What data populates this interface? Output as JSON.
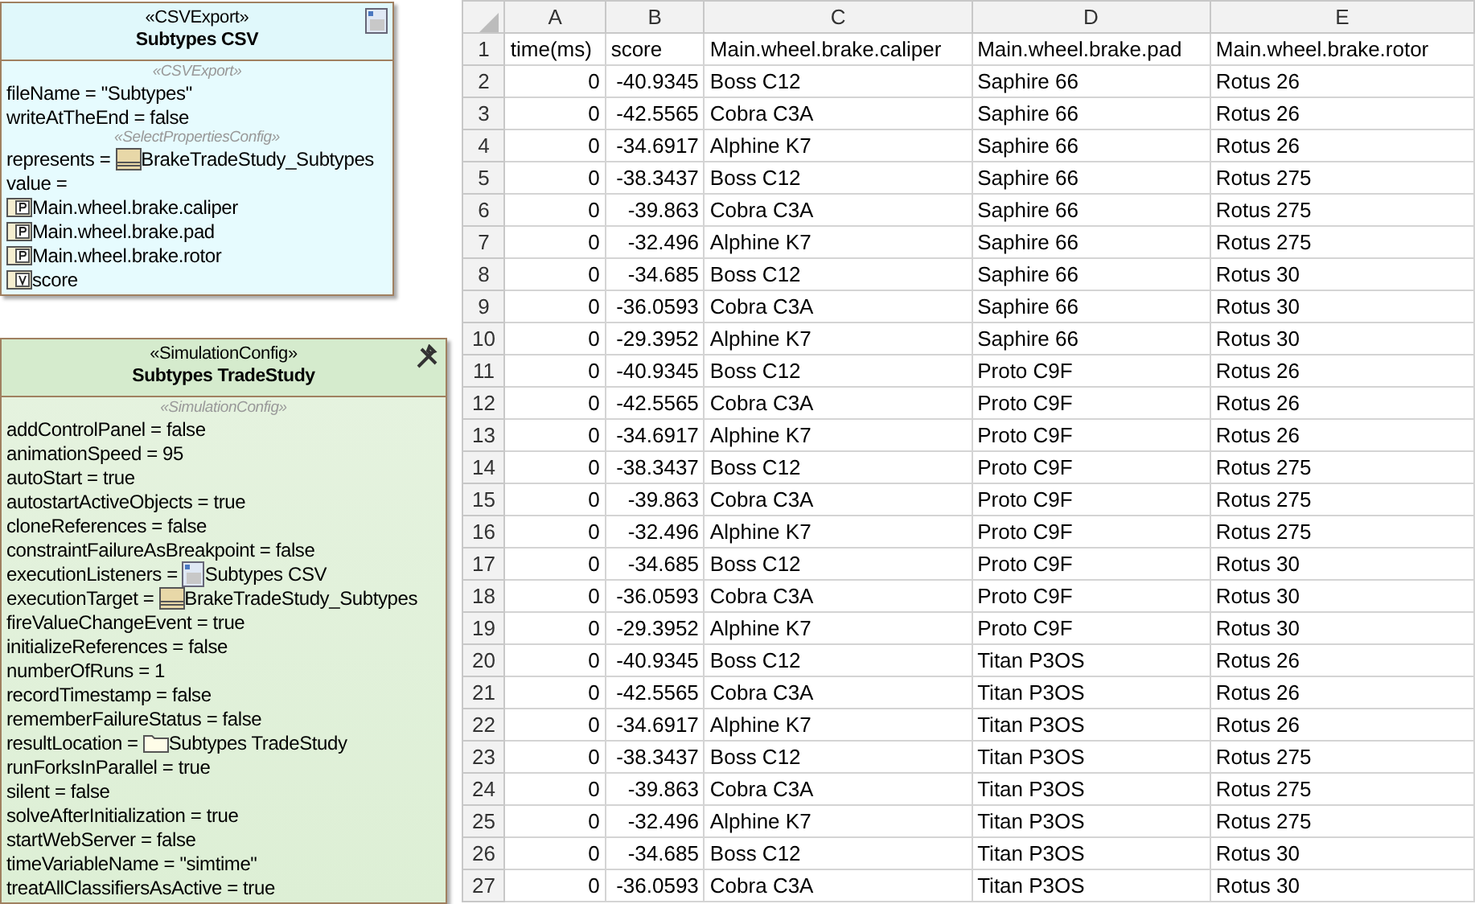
{
  "diagram": {
    "boxes": [
      {
        "kind": "csv",
        "stereotype": "«CSVExport»",
        "title": "Subtypes CSV",
        "sections": [
          {
            "stereotype": "«CSVExport»",
            "properties": [
              {
                "label": "fileName = \"Subtypes\""
              },
              {
                "label": "writeAtTheEnd = false"
              }
            ]
          },
          {
            "stereotype": "«SelectPropertiesConfig»",
            "properties": [
              {
                "label": "represents =",
                "kind": "block",
                "value": "BrakeTradeStudy_Subtypes"
              },
              {
                "label": "value ="
              },
              {
                "kind": "part",
                "value": "Main.wheel.brake.caliper"
              },
              {
                "kind": "part",
                "value": "Main.wheel.brake.pad"
              },
              {
                "kind": "part",
                "value": "Main.wheel.brake.rotor"
              },
              {
                "kind": "valueprop",
                "value": "score"
              }
            ]
          }
        ]
      },
      {
        "kind": "sim",
        "stereotype": "«SimulationConfig»",
        "title": "Subtypes TradeStudy",
        "sections": [
          {
            "stereotype": "«SimulationConfig»",
            "properties": [
              {
                "label": "addControlPanel = false"
              },
              {
                "label": "animationSpeed = 95"
              },
              {
                "label": "autoStart = true"
              },
              {
                "label": "autostartActiveObjects = true"
              },
              {
                "label": "cloneReferences = false"
              },
              {
                "label": "constraintFailureAsBreakpoint = false"
              },
              {
                "label": "executionListeners =",
                "kind": "csv",
                "value": "Subtypes CSV"
              },
              {
                "label": "executionTarget =",
                "kind": "block",
                "value": "BrakeTradeStudy_Subtypes"
              },
              {
                "label": "fireValueChangeEvent = true"
              },
              {
                "label": "initializeReferences = false"
              },
              {
                "label": "numberOfRuns = 1"
              },
              {
                "label": "recordTimestamp = false"
              },
              {
                "label": "rememberFailureStatus = false"
              },
              {
                "label": "resultLocation =",
                "kind": "folder",
                "value": "Subtypes TradeStudy"
              },
              {
                "label": "runForksInParallel = true"
              },
              {
                "label": "silent = false"
              },
              {
                "label": "solveAfterInitialization = true"
              },
              {
                "label": "startWebServer = false"
              },
              {
                "label": "timeVariableName = \"simtime\""
              },
              {
                "label": "treatAllClassifiersAsActive = true"
              }
            ]
          }
        ]
      }
    ]
  },
  "sheet": {
    "columns": [
      "A",
      "B",
      "C",
      "D",
      "E"
    ],
    "rows": [
      {
        "number": "1",
        "cells": [
          "time(ms)",
          "score",
          "Main.wheel.brake.caliper",
          "Main.wheel.brake.pad",
          "Main.wheel.brake.rotor"
        ]
      },
      {
        "number": "2",
        "cells": [
          "0",
          "-40.9345",
          "Boss C12",
          "Saphire 66",
          "Rotus 26"
        ]
      },
      {
        "number": "3",
        "cells": [
          "0",
          "-42.5565",
          "Cobra C3A",
          "Saphire 66",
          "Rotus 26"
        ]
      },
      {
        "number": "4",
        "cells": [
          "0",
          "-34.6917",
          "Alphine K7",
          "Saphire 66",
          "Rotus 26"
        ]
      },
      {
        "number": "5",
        "cells": [
          "0",
          "-38.3437",
          "Boss C12",
          "Saphire 66",
          "Rotus 275"
        ]
      },
      {
        "number": "6",
        "cells": [
          "0",
          "-39.863",
          "Cobra C3A",
          "Saphire 66",
          "Rotus 275"
        ]
      },
      {
        "number": "7",
        "cells": [
          "0",
          "-32.496",
          "Alphine K7",
          "Saphire 66",
          "Rotus 275"
        ]
      },
      {
        "number": "8",
        "cells": [
          "0",
          "-34.685",
          "Boss C12",
          "Saphire 66",
          "Rotus 30"
        ]
      },
      {
        "number": "9",
        "cells": [
          "0",
          "-36.0593",
          "Cobra C3A",
          "Saphire 66",
          "Rotus 30"
        ]
      },
      {
        "number": "10",
        "cells": [
          "0",
          "-29.3952",
          "Alphine K7",
          "Saphire 66",
          "Rotus 30"
        ]
      },
      {
        "number": "11",
        "cells": [
          "0",
          "-40.9345",
          "Boss C12",
          "Proto C9F",
          "Rotus 26"
        ]
      },
      {
        "number": "12",
        "cells": [
          "0",
          "-42.5565",
          "Cobra C3A",
          "Proto C9F",
          "Rotus 26"
        ]
      },
      {
        "number": "13",
        "cells": [
          "0",
          "-34.6917",
          "Alphine K7",
          "Proto C9F",
          "Rotus 26"
        ]
      },
      {
        "number": "14",
        "cells": [
          "0",
          "-38.3437",
          "Boss C12",
          "Proto C9F",
          "Rotus 275"
        ]
      },
      {
        "number": "15",
        "cells": [
          "0",
          "-39.863",
          "Cobra C3A",
          "Proto C9F",
          "Rotus 275"
        ]
      },
      {
        "number": "16",
        "cells": [
          "0",
          "-32.496",
          "Alphine K7",
          "Proto C9F",
          "Rotus 275"
        ]
      },
      {
        "number": "17",
        "cells": [
          "0",
          "-34.685",
          "Boss C12",
          "Proto C9F",
          "Rotus 30"
        ]
      },
      {
        "number": "18",
        "cells": [
          "0",
          "-36.0593",
          "Cobra C3A",
          "Proto C9F",
          "Rotus 30"
        ]
      },
      {
        "number": "19",
        "cells": [
          "0",
          "-29.3952",
          "Alphine K7",
          "Proto C9F",
          "Rotus 30"
        ]
      },
      {
        "number": "20",
        "cells": [
          "0",
          "-40.9345",
          "Boss C12",
          "Titan P3OS",
          "Rotus 26"
        ]
      },
      {
        "number": "21",
        "cells": [
          "0",
          "-42.5565",
          "Cobra C3A",
          "Titan P3OS",
          "Rotus 26"
        ]
      },
      {
        "number": "22",
        "cells": [
          "0",
          "-34.6917",
          "Alphine K7",
          "Titan P3OS",
          "Rotus 26"
        ]
      },
      {
        "number": "23",
        "cells": [
          "0",
          "-38.3437",
          "Boss C12",
          "Titan P3OS",
          "Rotus 275"
        ]
      },
      {
        "number": "24",
        "cells": [
          "0",
          "-39.863",
          "Cobra C3A",
          "Titan P3OS",
          "Rotus 275"
        ]
      },
      {
        "number": "25",
        "cells": [
          "0",
          "-32.496",
          "Alphine K7",
          "Titan P3OS",
          "Rotus 275"
        ]
      },
      {
        "number": "26",
        "cells": [
          "0",
          "-34.685",
          "Boss C12",
          "Titan P3OS",
          "Rotus 30"
        ]
      },
      {
        "number": "27",
        "cells": [
          "0",
          "-36.0593",
          "Cobra C3A",
          "Titan P3OS",
          "Rotus 30"
        ]
      }
    ]
  }
}
